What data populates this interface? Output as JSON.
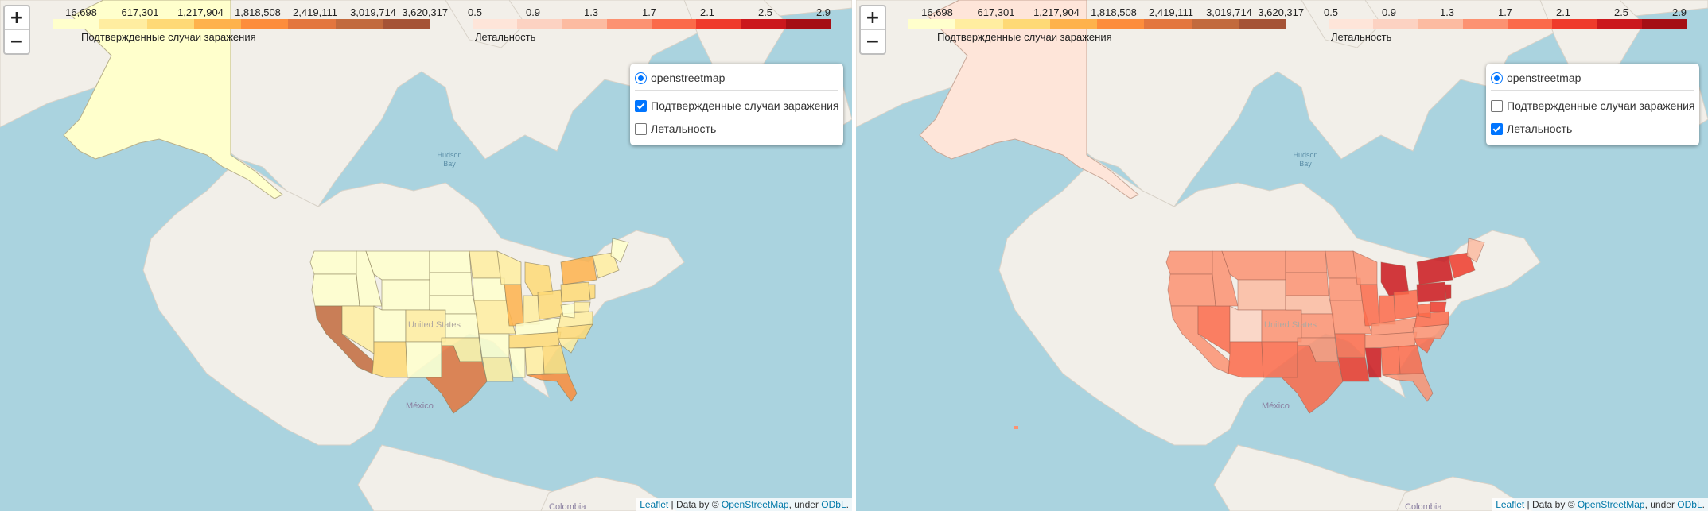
{
  "basemap": {
    "water_color": "#aad3df",
    "land_color": "#f2efe9",
    "labels": {
      "country": "United States",
      "mexico": "México",
      "colombia": "Colombia",
      "bay": "Hudson\nBay"
    }
  },
  "zoom": {
    "in_label": "+",
    "out_label": "−"
  },
  "legend_cases": {
    "caption": "Подтвержденные случаи заражения",
    "ticks": [
      "16,698",
      "617,301",
      "1,217,904",
      "1,818,508",
      "2,419,111",
      "3,019,714",
      "3,620,317"
    ],
    "colors": [
      "#ffffcc",
      "#ffeda0",
      "#fed976",
      "#feb24c",
      "#fd8d3c",
      "#e3763e",
      "#c26a3d",
      "#a55336"
    ]
  },
  "legend_fatality": {
    "caption": "Летальность",
    "ticks": [
      "0.5",
      "0.9",
      "1.3",
      "1.7",
      "2.1",
      "2.5",
      "2.9"
    ],
    "colors": [
      "#fee5d9",
      "#fcd2c2",
      "#fcbba1",
      "#fc9272",
      "#fb6a4a",
      "#ef3b2c",
      "#cb181d",
      "#a50f15"
    ]
  },
  "layer_control": {
    "base_layer": "openstreetmap",
    "overlay_cases": "Подтвержденные случаи заражения",
    "overlay_fatality": "Летальность"
  },
  "panels": [
    {
      "name": "cases-map",
      "base_selected": true,
      "cases_checked": true,
      "fatality_checked": false
    },
    {
      "name": "fatality-map",
      "base_selected": true,
      "cases_checked": false,
      "fatality_checked": true
    }
  ],
  "attribution": {
    "leaflet": "Leaflet",
    "sep": " | Data by © ",
    "osm": "OpenStreetMap",
    "under": ", under ",
    "odbl": "ODbL",
    "end": "."
  }
}
